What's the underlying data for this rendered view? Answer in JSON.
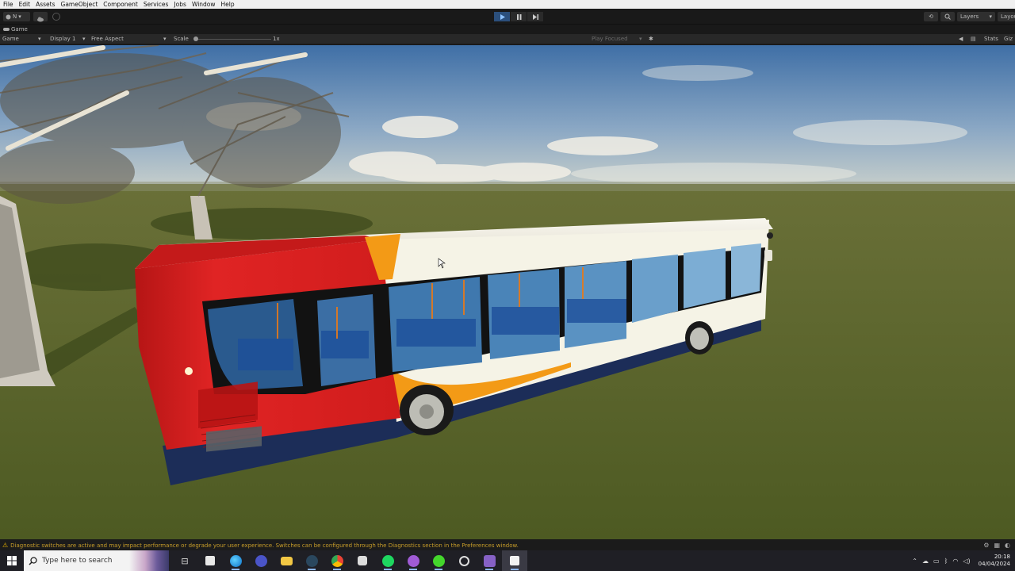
{
  "menu": [
    "File",
    "Edit",
    "Assets",
    "GameObject",
    "Component",
    "Services",
    "Jobs",
    "Window",
    "Help"
  ],
  "toolbar": {
    "account_label": "N",
    "layers_label": "Layers",
    "layout_label": "Layout"
  },
  "tab": {
    "label": "Game"
  },
  "game_toolbar": {
    "mode": "Game",
    "display": "Display 1",
    "aspect": "Free Aspect",
    "scale_label": "Scale",
    "scale_value": "1x",
    "play_focused": "Play Focused",
    "stats": "Stats",
    "gizmos": "Giz"
  },
  "diagnostics": {
    "message": "Diagnostic switches are active and may impact performance or degrade your user experience. Switches can be configured through the Diagnostics section in the Preferences window."
  },
  "taskbar": {
    "search_placeholder": "Type here to search",
    "time": "20:18",
    "date": "04/04/2024"
  },
  "colors": {
    "bus_red": "#d51c1c",
    "bus_orange": "#f39a16",
    "bus_cream": "#f5f3e6",
    "bus_blue": "#1c2d58",
    "grass": "#59652a",
    "warning": "#e8b300"
  },
  "icons": {
    "play": "play-icon",
    "pause": "pause-icon",
    "step": "step-icon"
  }
}
